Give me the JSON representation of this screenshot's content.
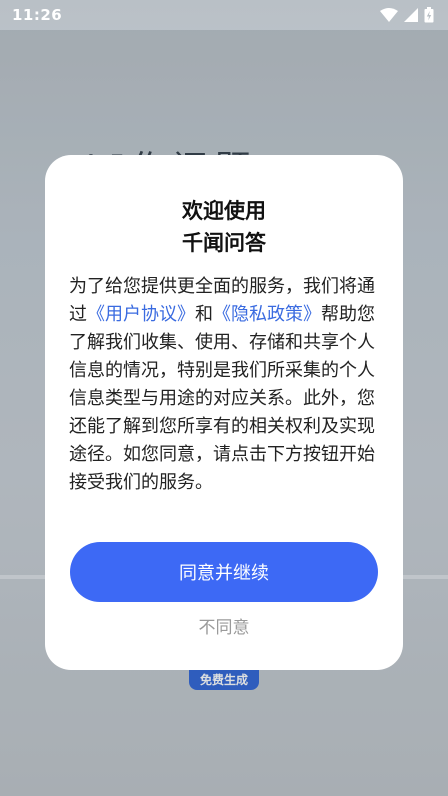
{
  "status_bar": {
    "time": "11:26"
  },
  "background": {
    "heading": "AI作问题",
    "badge": "免费生成"
  },
  "dialog": {
    "title_line1": "欢迎使用",
    "title_line2": "千闻问答",
    "body_part1": "为了给您提供更全面的服务，我们将通过",
    "user_agreement_link": "《用户协议》",
    "body_and": "和",
    "privacy_policy_link": "《隐私政策》",
    "body_part2": "帮助您了解我们收集、使用、存储和共享个人信息的情况，特别是我们所采集的个人信息类型与用途的对应关系。此外，您还能了解到您所享有的相关权利及实现途径。如您同意，请点击下方按钮开始接受我们的服务。",
    "agree_button": "同意并继续",
    "disagree_button": "不同意"
  },
  "colors": {
    "primary_button": "#3d69f5",
    "link": "#3a6be0"
  }
}
